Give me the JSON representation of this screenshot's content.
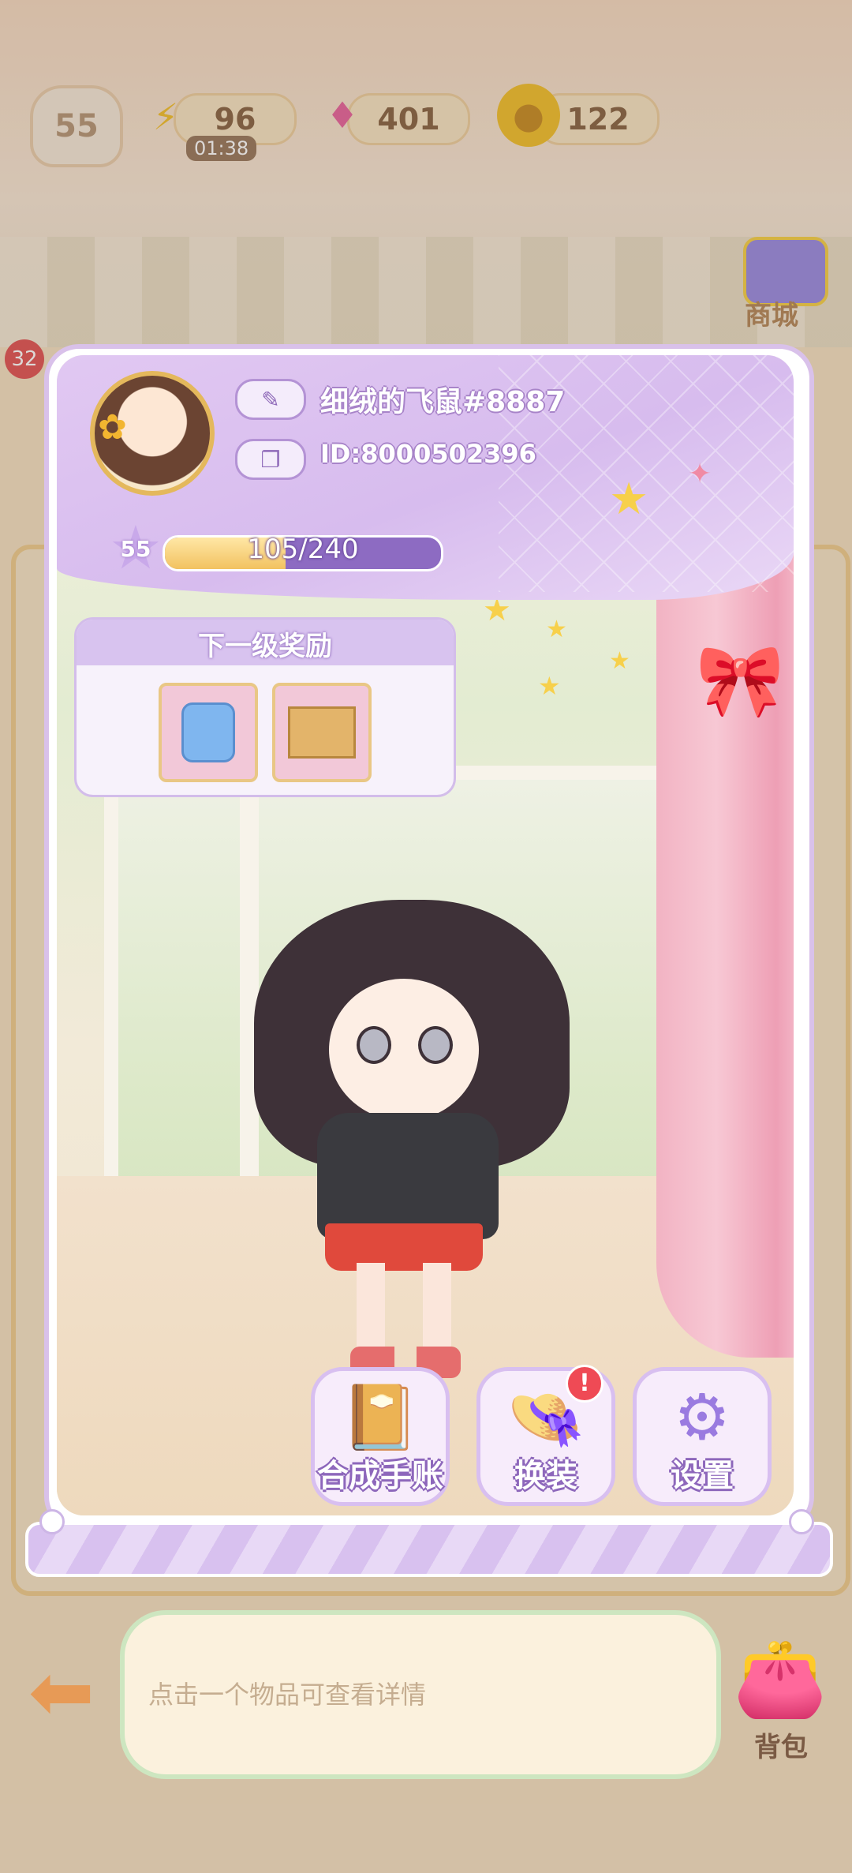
{
  "status_bar": {
    "player_level": "55",
    "energy_value": "96",
    "energy_timer": "01:38",
    "gems_value": "401",
    "coins_value": "122",
    "shop_label": "商城",
    "left_badge": "32"
  },
  "profile": {
    "nickname": "细绒的飞鼠#8887",
    "player_id": "ID:8000502396",
    "level": "55",
    "xp_text": "105/240",
    "xp_progress": 0.4375
  },
  "rewards": {
    "title": "下一级奖励",
    "items": [
      {
        "icon": "blue-bag-icon"
      },
      {
        "icon": "surprise-box-icon"
      }
    ]
  },
  "actions": {
    "collection_label": "合成手账",
    "dressup_label": "换装",
    "settings_label": "设置",
    "dressup_alert": "!"
  },
  "bottom": {
    "hint_text": "点击一个物品可查看详情",
    "bag_label": "背包"
  },
  "colors": {
    "panel_purple": "#d7bcee",
    "xp_bar": "#8d6bc2",
    "xp_fill": "#f2c260",
    "curtain": "#f2b3c3"
  }
}
